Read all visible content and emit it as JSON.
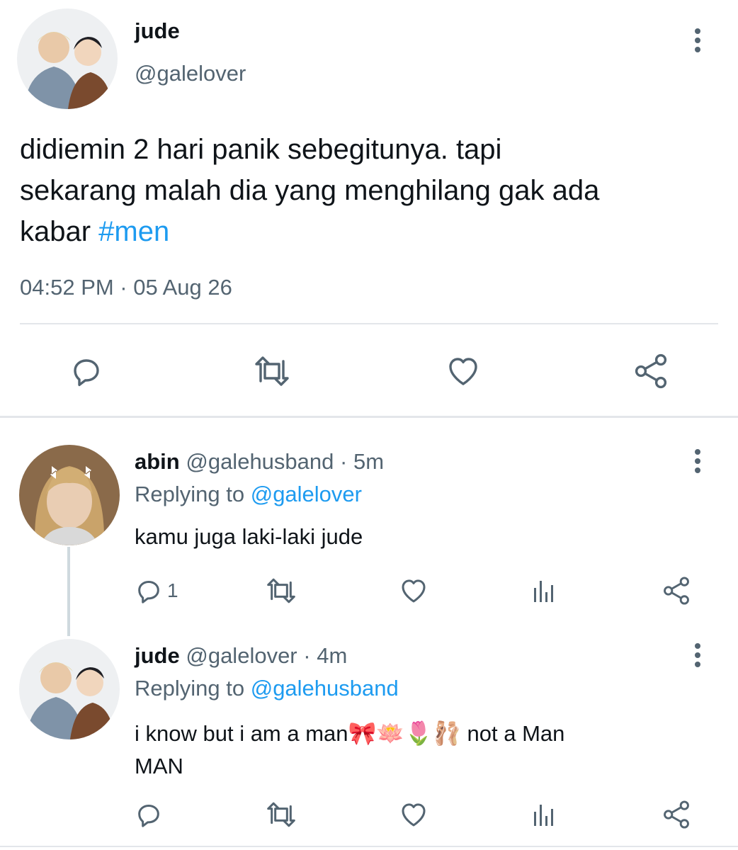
{
  "main_tweet": {
    "name": "jude",
    "handle": "@galelover",
    "text_lines": [
      "didiemin 2 hari panik sebegitunya. tapi",
      "sekarang malah dia yang menghilang gak ada",
      "kabar "
    ],
    "hashtag": "#men",
    "timestamp": "04:52 PM · 05 Aug 26",
    "icons": {
      "more": "more-vertical-icon",
      "reply": "reply-icon",
      "retweet": "retweet-icon",
      "like": "heart-icon",
      "share": "share-icon"
    }
  },
  "replies": [
    {
      "name": "abin",
      "handle": "@galehusband",
      "time": "· 5m",
      "replying_prefix": "Replying to ",
      "replying_to": "@galelover",
      "text_lines": [
        "kamu juga laki-laki jude"
      ],
      "reply_count": "1",
      "icons": {
        "more": "more-vertical-icon",
        "reply": "reply-icon",
        "retweet": "retweet-icon",
        "like": "heart-icon",
        "views": "analytics-icon",
        "share": "share-icon"
      }
    },
    {
      "name": "jude",
      "handle": "@galelover",
      "time": "· 4m",
      "replying_prefix": "Replying to ",
      "replying_to": "@galehusband",
      "text_line1": "i know but i am a man",
      "emojis": "🎀🪷🌷🩰",
      "text_line1_end": " not a Man",
      "text_line2": "MAN",
      "icons": {
        "more": "more-vertical-icon",
        "reply": "reply-icon",
        "retweet": "retweet-icon",
        "like": "heart-icon",
        "views": "analytics-icon",
        "share": "share-icon"
      }
    }
  ],
  "colors": {
    "link": "#1d9bf0",
    "muted": "#536471",
    "text": "#0f1419",
    "divider": "#e3e6ea"
  }
}
